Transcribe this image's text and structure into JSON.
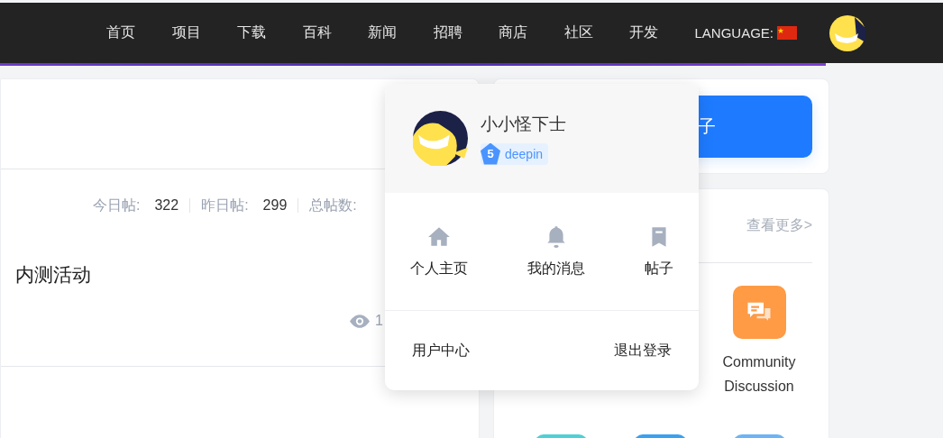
{
  "nav": {
    "items": [
      "首页",
      "项目",
      "下载",
      "百科",
      "新闻",
      "招聘",
      "商店",
      "社区",
      "开发"
    ],
    "language_label": "LANGUAGE:"
  },
  "forum_stats": [
    {
      "label": "今日帖:",
      "value": "322"
    },
    {
      "label": "昨日帖:",
      "value": "299"
    },
    {
      "label": "总帖数:"
    }
  ],
  "post": {
    "title": "内测活动",
    "views": "1"
  },
  "post_button": {
    "label": "子"
  },
  "hot_section": {
    "more_link": "查看更多>",
    "apps": [
      {
        "label": "Community Discussion",
        "color": "#ff9a45"
      },
      {
        "color": "#4dd0d6"
      },
      {
        "color": "#3aa0f0"
      },
      {
        "color": "#6cb4f5"
      }
    ]
  },
  "user_menu": {
    "name": "小小怪下士",
    "level": "5",
    "badge": "deepin",
    "shortcuts": [
      {
        "label": "个人主页",
        "kind": "home"
      },
      {
        "label": "我的消息",
        "kind": "bell"
      },
      {
        "label": "帖子",
        "kind": "bookmark"
      }
    ],
    "links": [
      "用户中心",
      "退出登录"
    ]
  }
}
